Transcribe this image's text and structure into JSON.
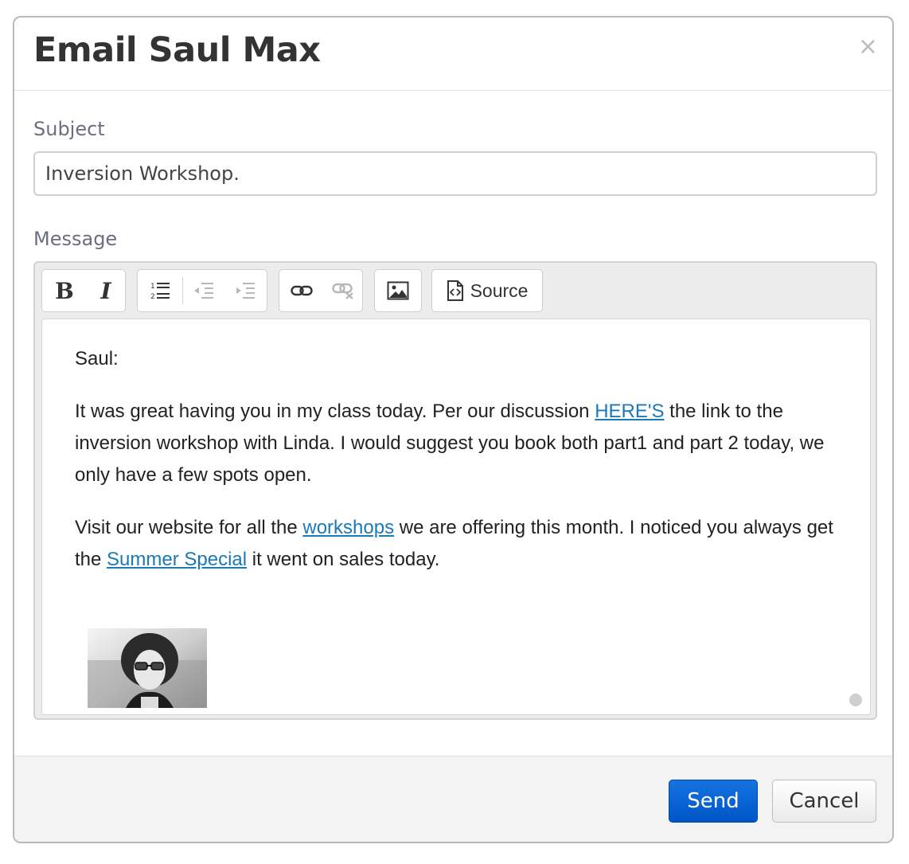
{
  "dialog": {
    "title": "Email Saul Max",
    "close_symbol": "×"
  },
  "subject": {
    "label": "Subject",
    "value": "Inversion Workshop."
  },
  "message": {
    "label": "Message",
    "toolbar": {
      "bold": "B",
      "italic": "I",
      "source_label": "Source",
      "icons": [
        "bold-icon",
        "italic-icon",
        "numbered-list-icon",
        "outdent-icon",
        "indent-icon",
        "link-icon",
        "unlink-icon",
        "image-icon",
        "source-icon"
      ]
    },
    "body": {
      "greeting": "Saul:",
      "p1_before": "It was great having you in my class today. Per our discussion ",
      "p1_link": "HERE'S",
      "p1_after": " the link to the inversion workshop with Linda. I would suggest you book both part1 and part 2 today, we only have a few spots open.",
      "p2_before": "Visit our website for all the ",
      "p2_link1": "workshops",
      "p2_middle": " we are offering this month. I noticed you always get the ",
      "p2_link2": "Summer Special",
      "p2_after": " it went on sales today."
    }
  },
  "footer": {
    "send_label": "Send",
    "cancel_label": "Cancel"
  },
  "colors": {
    "link": "#1a7ab8",
    "send_button": "#0a63d6",
    "label_text": "#6b6e80"
  }
}
